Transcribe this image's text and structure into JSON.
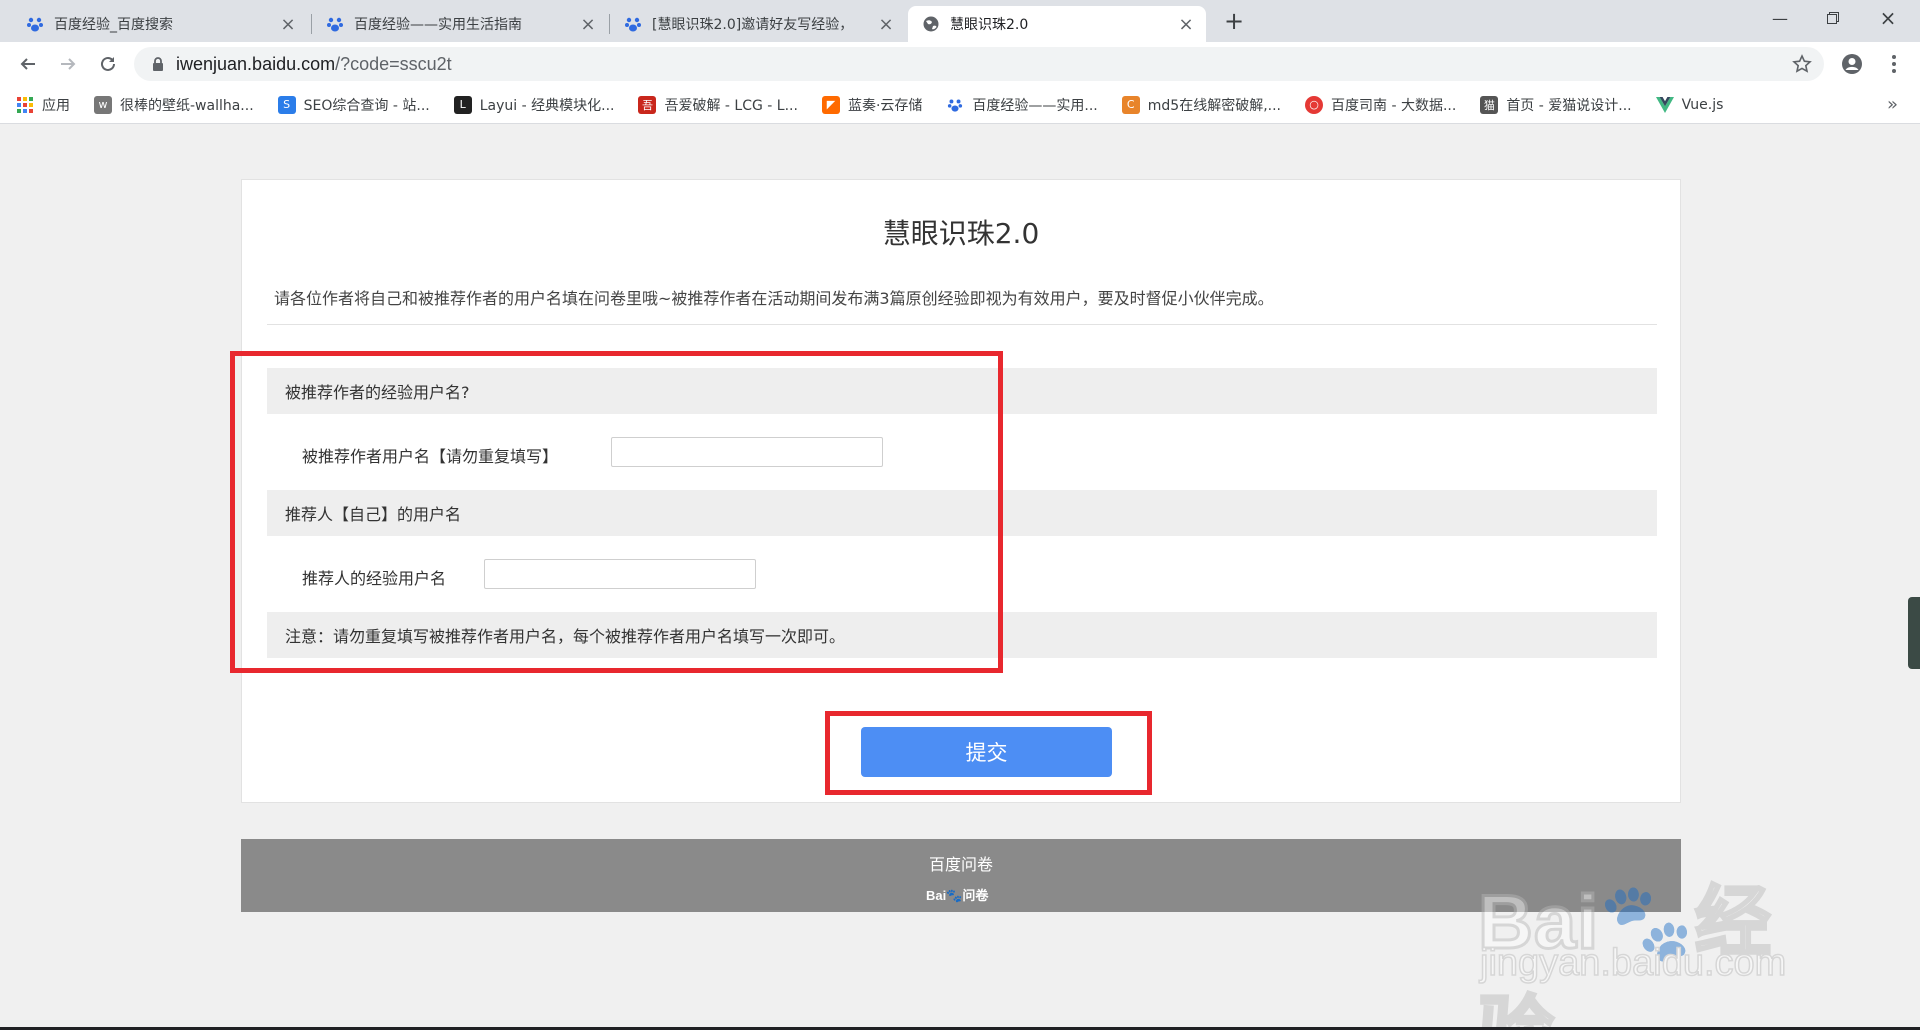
{
  "browser": {
    "tabs": [
      {
        "title": "百度经验_百度搜索",
        "icon": "baidu-paw-icon"
      },
      {
        "title": "百度经验——实用生活指南",
        "icon": "baidu-paw-icon"
      },
      {
        "title": "[慧眼识珠2.0]邀请好友写经验，",
        "icon": "baidu-paw-icon"
      },
      {
        "title": "慧眼识珠2.0",
        "icon": "globe-icon"
      }
    ],
    "url_host": "iwenjuan.baidu.com",
    "url_path": "/?code=sscu2t",
    "bookmarks": [
      {
        "label": "应用",
        "color": "#e94235"
      },
      {
        "label": "很棒的壁纸-wallha...",
        "color": "#777777"
      },
      {
        "label": "SEO综合查询 - 站...",
        "color": "#2b7de9"
      },
      {
        "label": "Layui - 经典模块化...",
        "color": "#222222"
      },
      {
        "label": "吾爱破解 - LCG - L...",
        "color": "#c9271c"
      },
      {
        "label": "蓝奏·云存储",
        "color": "#ff6a00"
      },
      {
        "label": "百度经验——实用...",
        "color": "#2f6ae0"
      },
      {
        "label": "md5在线解密破解,...",
        "color": "#e8842a"
      },
      {
        "label": "百度司南 - 大数据...",
        "color": "#e53935"
      },
      {
        "label": "首页 - 爱猫说设计...",
        "color": "#555555"
      },
      {
        "label": "Vue.js",
        "color": "#41b883"
      }
    ],
    "bookmarks_more": "»"
  },
  "survey": {
    "title": "慧眼识珠2.0",
    "description": "请各位作者将自己和被推荐作者的用户名填在问卷里哦~被推荐作者在活动期间发布满3篇原创经验即视为有效用户，要及时督促小伙伴完成。",
    "q1_title": "被推荐作者的经验用户名?",
    "q1_label": "被推荐作者用户名【请勿重复填写】",
    "q1_value": "",
    "q2_title": "推荐人【自己】的用户名",
    "q2_label": "推荐人的经验用户名",
    "q2_value": "",
    "notice": "注意：请勿重复填写被推荐作者用户名，每个被推荐作者用户名填写一次即可。",
    "submit_label": "提交"
  },
  "footer": {
    "title": "百度问卷",
    "logo_text": "Bai🐾问卷"
  },
  "watermark": {
    "main": "Bai🐾经验",
    "sub": "jingyan.baidu.com"
  },
  "colors": {
    "accent": "#4d8ef4",
    "highlight": "#e8282e",
    "footer": "#8a8a8a"
  }
}
